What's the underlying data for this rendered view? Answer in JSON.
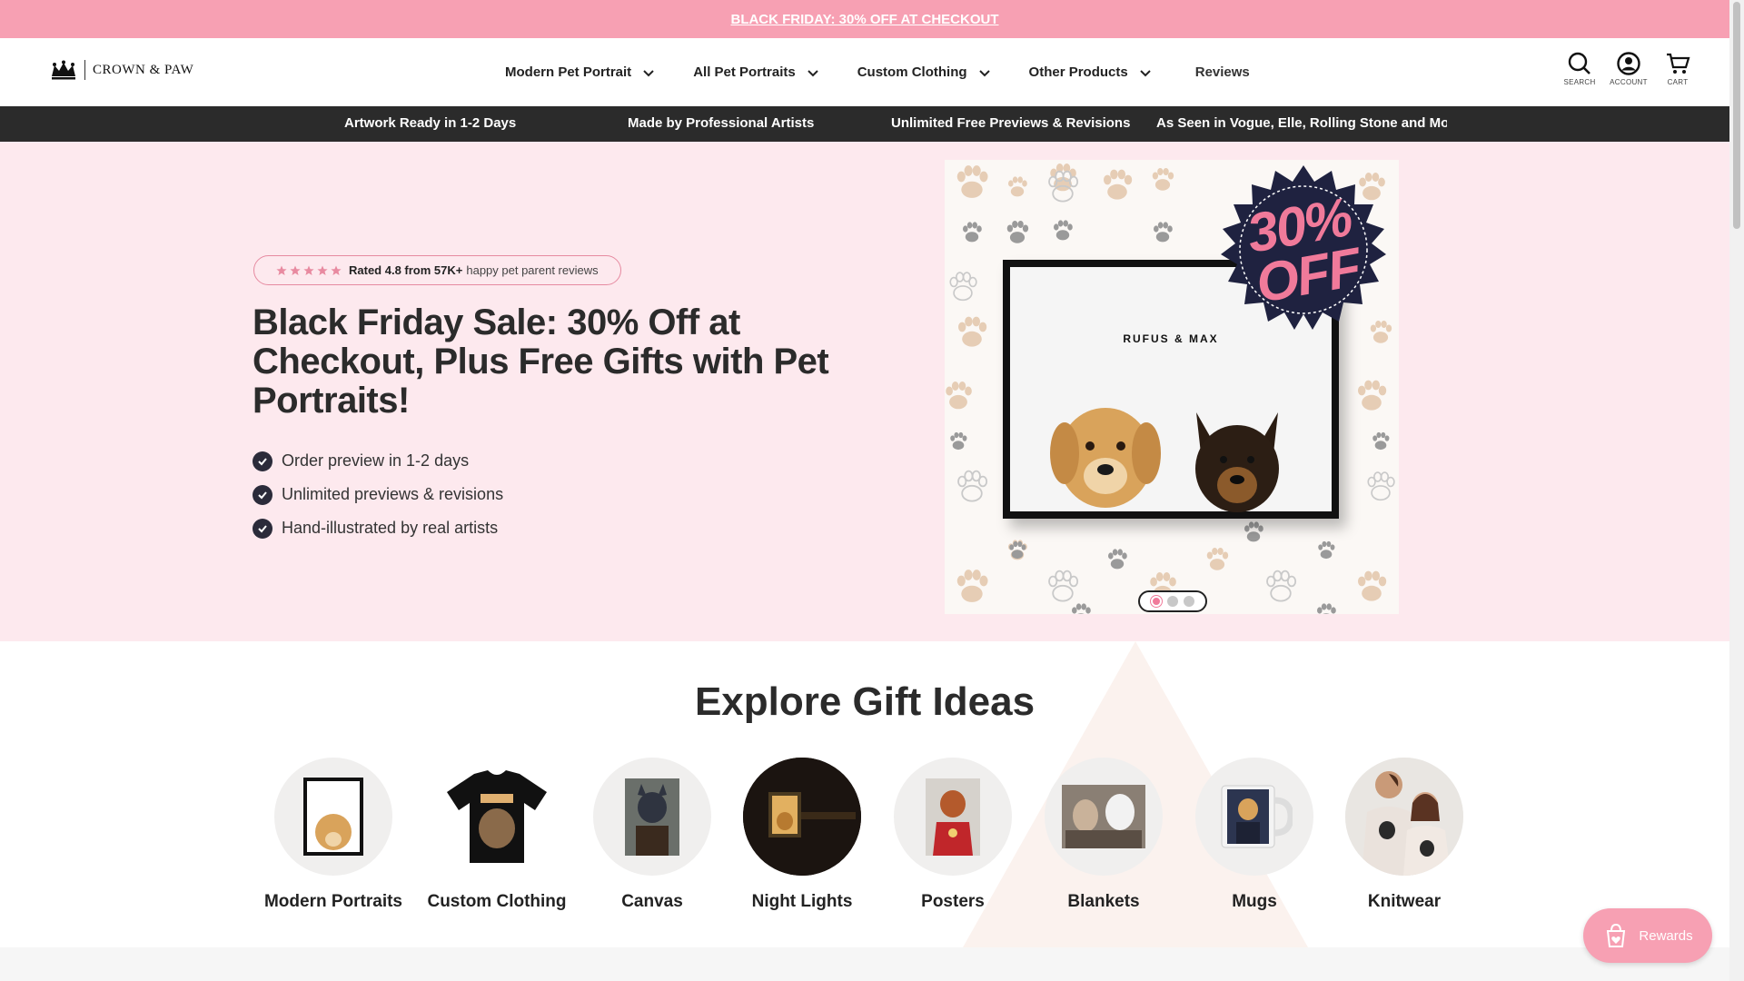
{
  "announcement": {
    "text": "BLACK FRIDAY: 30% OFF AT CHECKOUT"
  },
  "header": {
    "logo_text": "CROWN & PAW",
    "nav": [
      {
        "label": "Modern Pet Portrait",
        "has_dropdown": true
      },
      {
        "label": "All Pet Portraits",
        "has_dropdown": true
      },
      {
        "label": "Custom Clothing",
        "has_dropdown": true
      },
      {
        "label": "Other Products",
        "has_dropdown": true
      },
      {
        "label": "Reviews",
        "has_dropdown": false
      }
    ],
    "icons": [
      {
        "name": "search-icon",
        "label": "SEARCH"
      },
      {
        "name": "account-icon",
        "label": "ACCOUNT"
      },
      {
        "name": "cart-icon",
        "label": "CART"
      }
    ]
  },
  "trust_bar": [
    "Artwork Ready in 1-2 Days",
    "Made by Professional Artists",
    "Unlimited Free Previews & Revisions",
    "As Seen in Vogue, Elle, Rolling Stone and More"
  ],
  "hero": {
    "rating_strong": "Rated 4.8 from 57K+",
    "rating_light": "happy pet parent reviews",
    "rating_stars": 5,
    "title": "Black Friday Sale: 30% Off at Checkout, Plus Free Gifts with Pet Portraits!",
    "bullets": [
      "Order preview in 1-2 days",
      "Unlimited previews & revisions",
      "Hand-illustrated by real artists"
    ],
    "image": {
      "frame_caption": "RUFUS & MAX",
      "badge_line1": "30%",
      "badge_line2": "OFF"
    },
    "carousel": {
      "count": 3,
      "active": 0
    }
  },
  "explore": {
    "title": "Explore Gift Ideas",
    "categories": [
      {
        "label": "Modern Portraits",
        "icon": "framed-portrait"
      },
      {
        "label": "Custom Clothing",
        "icon": "tshirt"
      },
      {
        "label": "Canvas",
        "icon": "canvas-portrait"
      },
      {
        "label": "Night Lights",
        "icon": "night-light"
      },
      {
        "label": "Posters",
        "icon": "poster"
      },
      {
        "label": "Blankets",
        "icon": "blanket"
      },
      {
        "label": "Mugs",
        "icon": "mug"
      },
      {
        "label": "Knitwear",
        "icon": "knitwear"
      }
    ]
  },
  "rewards": {
    "label": "Rewards"
  },
  "colors": {
    "accent_pink": "#f7a0b3",
    "hero_bg": "#fde9ee",
    "dark_bar": "#2b2b2b"
  }
}
